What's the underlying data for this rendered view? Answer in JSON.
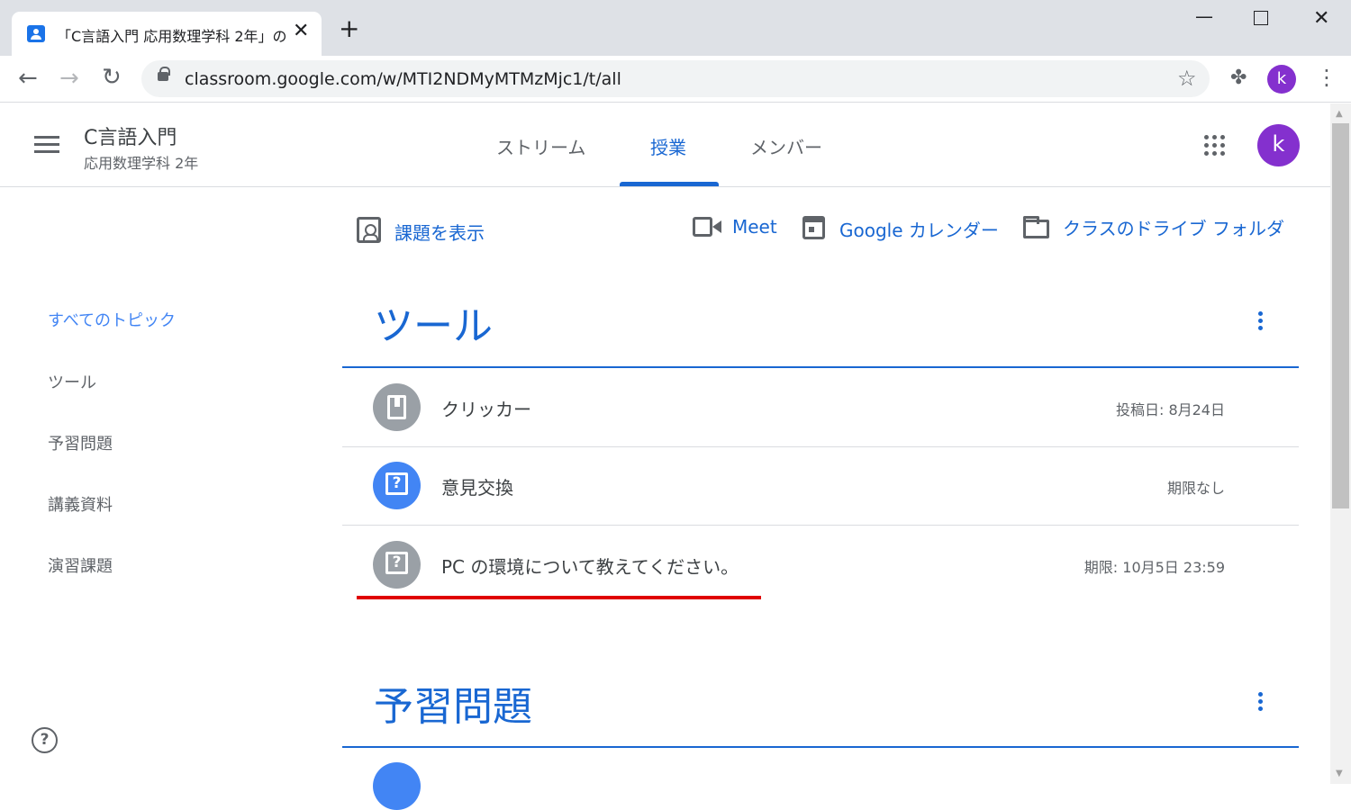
{
  "browser": {
    "tab_title": "「C言語入門 応用数理学科 2年」の",
    "url": "classroom.google.com/w/MTI2NDMyMTMzMjc1/t/all",
    "profile_initial": "k"
  },
  "header": {
    "class_name": "C言語入門",
    "class_section": "応用数理学科 2年",
    "tabs": [
      {
        "label": "ストリーム",
        "active": false
      },
      {
        "label": "授業",
        "active": true
      },
      {
        "label": "メンバー",
        "active": false
      }
    ],
    "profile_initial": "k"
  },
  "sidebar": {
    "topics": [
      {
        "label": "すべてのトピック",
        "active": true
      },
      {
        "label": "ツール",
        "active": false
      },
      {
        "label": "予習問題",
        "active": false
      },
      {
        "label": "講義資料",
        "active": false
      },
      {
        "label": "演習課題",
        "active": false
      }
    ]
  },
  "actions": {
    "view_assignments": "課題を表示",
    "meet": "Meet",
    "calendar": "Google カレンダー",
    "drive": "クラスのドライブ フォルダ"
  },
  "sections": [
    {
      "title": "ツール",
      "items": [
        {
          "icon": "material-icon",
          "title": "クリッカー",
          "date": "投稿日: 8月24日",
          "color": "gray"
        },
        {
          "icon": "question-icon",
          "title": "意見交換",
          "date": "期限なし",
          "color": "blue"
        },
        {
          "icon": "question-icon",
          "title": "PC の環境について教えてください。",
          "date": "期限: 10月5日 23:59",
          "color": "gray"
        }
      ]
    },
    {
      "title": "予習問題",
      "items": []
    }
  ],
  "colors": {
    "accent": "#1967d2",
    "avatar": "#8430ce",
    "highlight_underline": "#e00000"
  }
}
